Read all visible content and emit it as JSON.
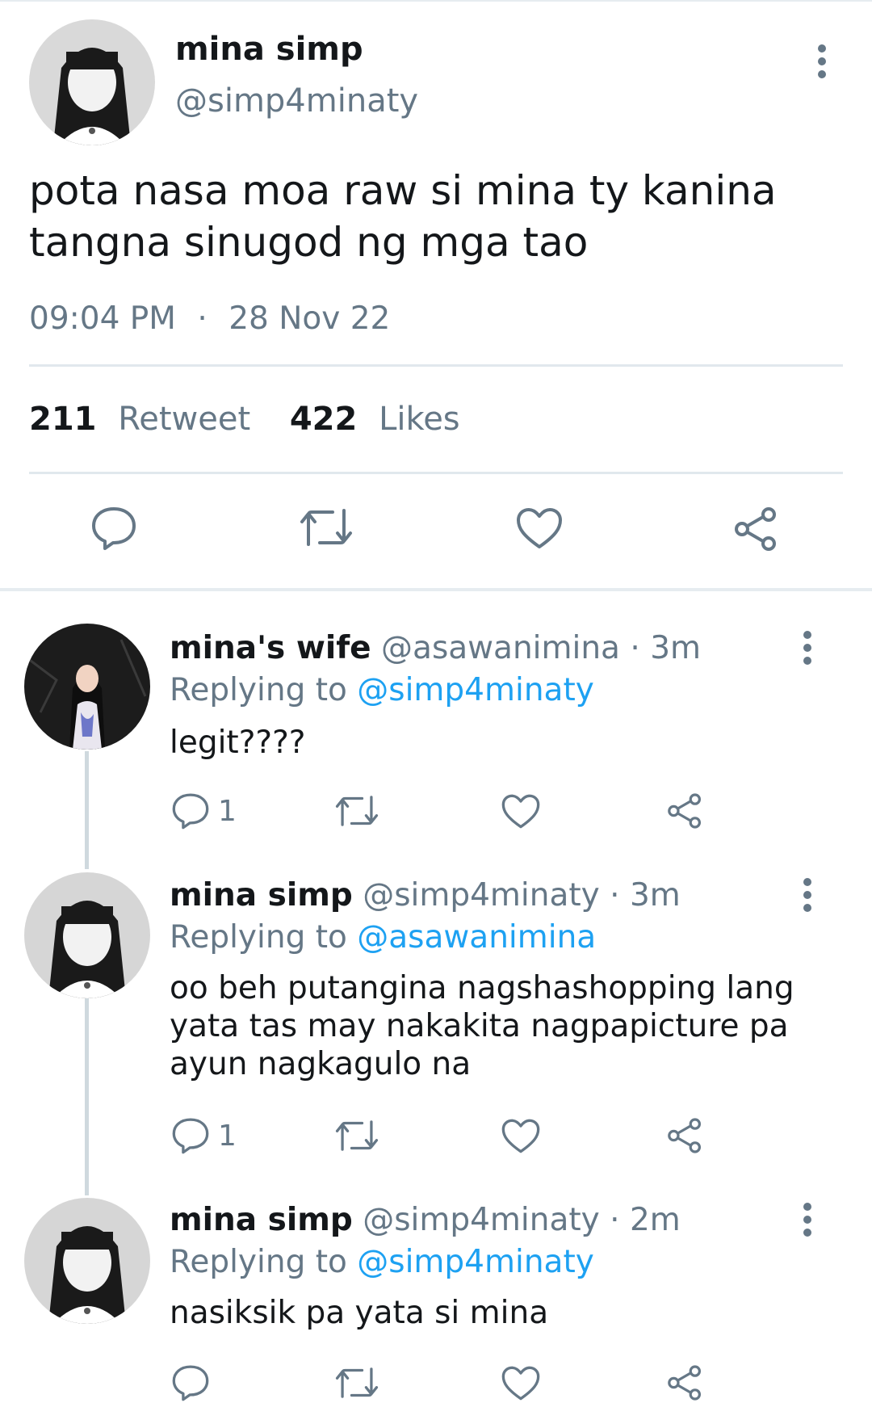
{
  "tweet": {
    "name": "mina simp",
    "handle": "@simp4minaty",
    "text": "pota nasa moa raw si mina ty kanina\ntangna sinugod ng mga tao",
    "time": "09:04 PM",
    "dot": "·",
    "date": "28 Nov 22",
    "retweets": "211",
    "retweets_label": "Retweet",
    "likes": "422",
    "likes_label": "Likes"
  },
  "replies": [
    {
      "name": "mina's wife",
      "handle": "@asawanimina",
      "dot": "·",
      "time": "3m",
      "replying_label": "Replying to",
      "replying_to": "@simp4minaty",
      "text": "legit????",
      "reply_count": "1"
    },
    {
      "name": "mina simp",
      "handle": "@simp4minaty",
      "dot": "·",
      "time": "3m",
      "replying_label": "Replying to",
      "replying_to": "@asawanimina",
      "text": "oo beh putangina nagshashopping lang\nyata tas may nakakita nagpapicture pa\nayun nagkagulo na",
      "reply_count": "1"
    },
    {
      "name": "mina simp",
      "handle": "@simp4minaty",
      "dot": "·",
      "time": "2m",
      "replying_label": "Replying to",
      "replying_to": "@simp4minaty",
      "text": "nasiksik pa yata si mina",
      "reply_count": ""
    }
  ],
  "icons": {
    "reply": "reply-bubble-icon",
    "retweet": "retweet-icon",
    "like": "heart-icon",
    "share": "share-icon",
    "more": "more-vertical-icon"
  },
  "colors": {
    "text": "#14171a",
    "muted": "#657786",
    "link": "#1da1f2",
    "divider": "#e1e8ed"
  }
}
